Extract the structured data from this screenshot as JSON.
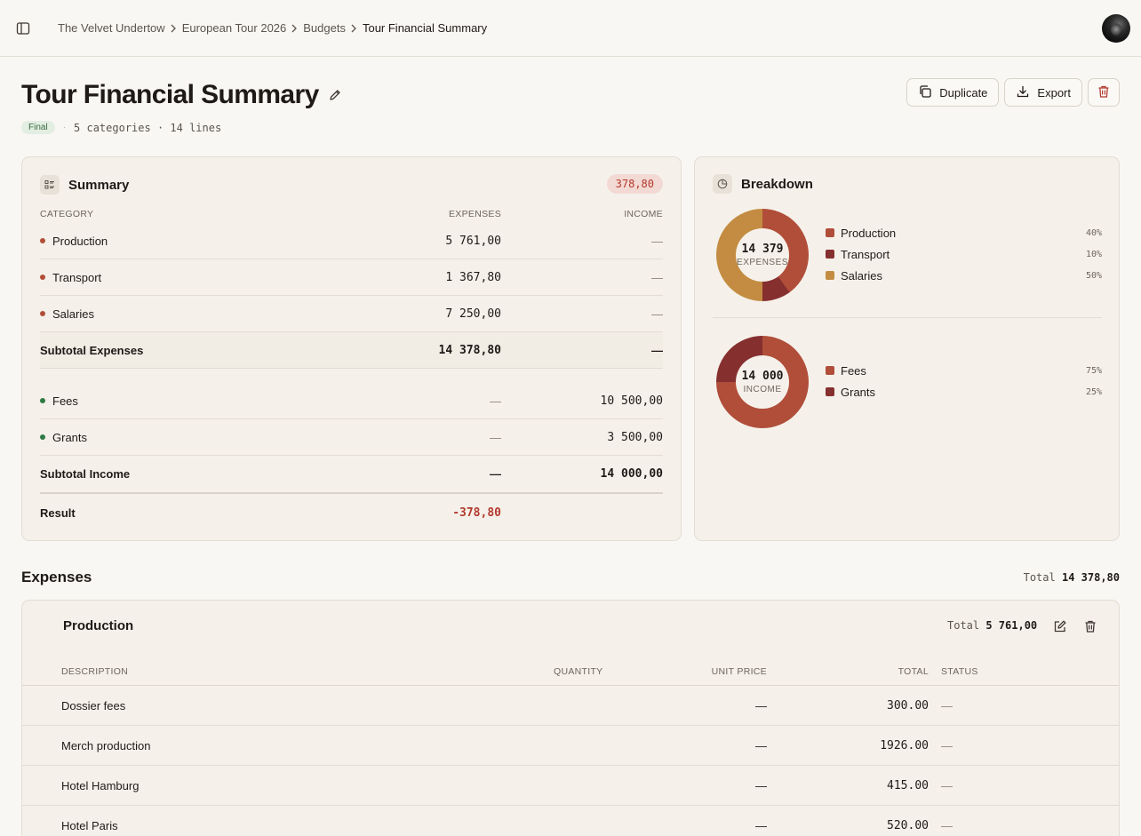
{
  "breadcrumb": [
    "The Velvet Undertow",
    "European Tour 2026",
    "Budgets",
    "Tour Financial Summary"
  ],
  "page": {
    "title": "Tour Financial Summary",
    "status": "Final",
    "meta": "5 categories · 14 lines"
  },
  "actions": {
    "duplicate": "Duplicate",
    "export": "Export"
  },
  "summary": {
    "title": "Summary",
    "result_badge": "378,80",
    "headers": {
      "category": "CATEGORY",
      "expenses": "EXPENSES",
      "income": "INCOME"
    },
    "expense_rows": [
      {
        "name": "Production",
        "expenses": "5 761,00",
        "income": "—"
      },
      {
        "name": "Transport",
        "expenses": "1 367,80",
        "income": "—"
      },
      {
        "name": "Salaries",
        "expenses": "7 250,00",
        "income": "—"
      }
    ],
    "subtotal_expenses": {
      "label": "Subtotal Expenses",
      "expenses": "14 378,80",
      "income": "—"
    },
    "income_rows": [
      {
        "name": "Fees",
        "expenses": "—",
        "income": "10 500,00"
      },
      {
        "name": "Grants",
        "expenses": "—",
        "income": "3 500,00"
      }
    ],
    "subtotal_income": {
      "label": "Subtotal Income",
      "expenses": "—",
      "income": "14 000,00"
    },
    "result": {
      "label": "Result",
      "value": "-378,80"
    }
  },
  "breakdown": {
    "title": "Breakdown",
    "expenses": {
      "total": "14 379",
      "label": "EXPENSES",
      "items": [
        {
          "name": "Production",
          "pct_label": "40%",
          "fraction": 0.4,
          "color": "#b04e3a"
        },
        {
          "name": "Transport",
          "pct_label": "10%",
          "fraction": 0.1,
          "color": "#862f2f"
        },
        {
          "name": "Salaries",
          "pct_label": "50%",
          "fraction": 0.5,
          "color": "#c48c42"
        }
      ]
    },
    "income": {
      "total": "14 000",
      "label": "INCOME",
      "items": [
        {
          "name": "Fees",
          "pct_label": "75%",
          "fraction": 0.75,
          "color": "#b04e3a"
        },
        {
          "name": "Grants",
          "pct_label": "25%",
          "fraction": 0.25,
          "color": "#862f2f"
        }
      ]
    }
  },
  "expenses_section": {
    "title": "Expenses",
    "total_label": "Total",
    "total_value": "14 378,80",
    "group": {
      "title": "Production",
      "total_label": "Total",
      "total_value": "5 761,00",
      "headers": {
        "description": "DESCRIPTION",
        "quantity": "QUANTITY",
        "unit_price": "UNIT PRICE",
        "total": "TOTAL",
        "status": "STATUS"
      },
      "lines": [
        {
          "description": "Dossier fees",
          "unit_price": "—",
          "total": "300.00",
          "status": "—"
        },
        {
          "description": "Merch production",
          "unit_price": "—",
          "total": "1926.00",
          "status": "—"
        },
        {
          "description": "Hotel Hamburg",
          "unit_price": "—",
          "total": "415.00",
          "status": "—"
        },
        {
          "description": "Hotel Paris",
          "unit_price": "—",
          "total": "520.00",
          "status": "—"
        }
      ]
    }
  },
  "colors": {
    "expense_dot": "#b04e3a",
    "income_dot": "#2f7a45",
    "negative": "#b3392e"
  }
}
